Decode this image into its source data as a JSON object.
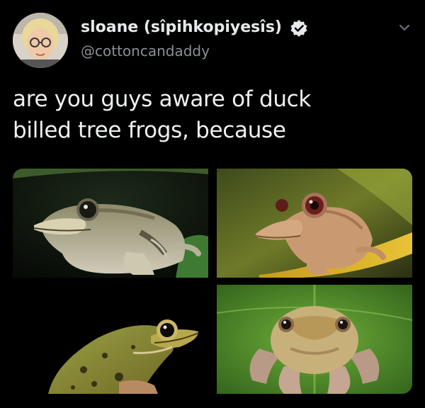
{
  "tweet": {
    "display_name": "sloane (sîpihkopiyesîs)",
    "handle": "@cottoncandaddy",
    "verified_icon": "verified-badge-icon",
    "more_icon": "chevron-down-icon",
    "text_lines": [
      "are you guys aware of duck",
      "billed tree frogs, because"
    ]
  },
  "media": {
    "photos": [
      {
        "subject": "frog-photo"
      },
      {
        "subject": "frog-photo"
      },
      {
        "subject": "frog-photo"
      },
      {
        "subject": "frog-photo"
      }
    ]
  },
  "colors": {
    "background": "#000000",
    "name_text": "#e7e9ea",
    "handle_text": "#8b8f94",
    "verified_blue": "#1d9bf0"
  }
}
